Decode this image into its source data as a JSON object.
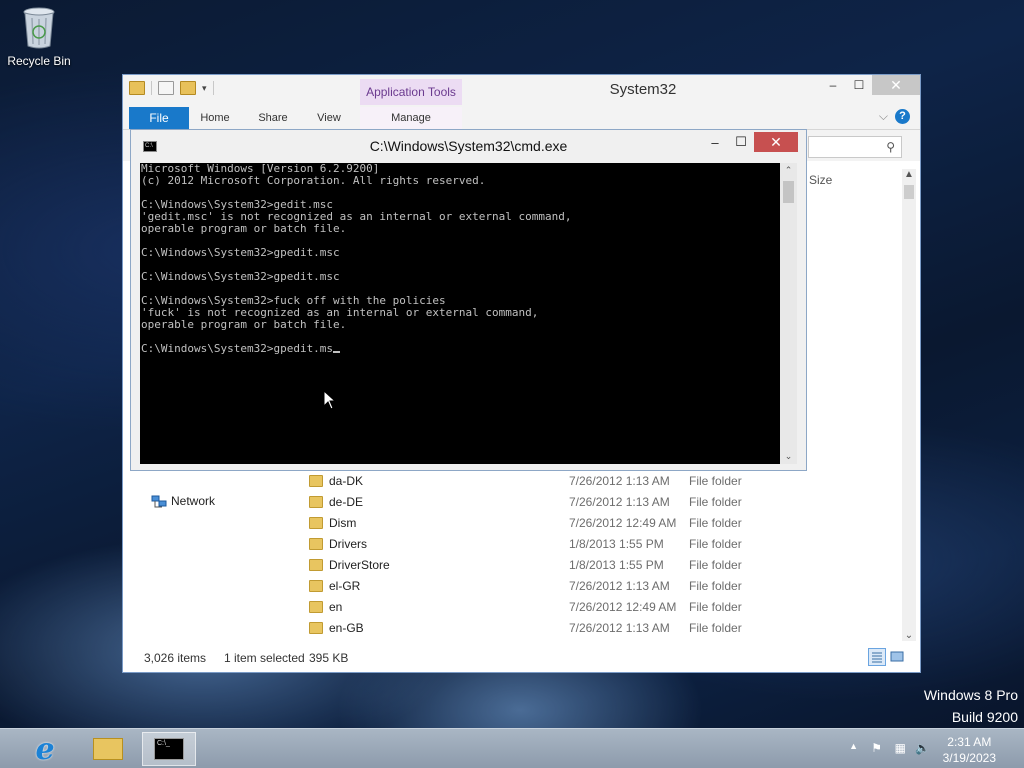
{
  "desktop": {
    "recycle_bin_label": "Recycle Bin",
    "watermark_line1": "Windows 8 Pro",
    "watermark_line2": "Build 9200"
  },
  "explorer": {
    "title": "System32",
    "context_tab": "Application Tools",
    "tabs": [
      "File",
      "Home",
      "Share",
      "View",
      "Manage"
    ],
    "column_size_label": "Size",
    "nav_network": "Network",
    "files": [
      {
        "name": "da-DK",
        "date": "7/26/2012 1:13 AM",
        "type": "File folder"
      },
      {
        "name": "de-DE",
        "date": "7/26/2012 1:13 AM",
        "type": "File folder"
      },
      {
        "name": "Dism",
        "date": "7/26/2012 12:49 AM",
        "type": "File folder"
      },
      {
        "name": "Drivers",
        "date": "1/8/2013 1:55 PM",
        "type": "File folder"
      },
      {
        "name": "DriverStore",
        "date": "1/8/2013 1:55 PM",
        "type": "File folder"
      },
      {
        "name": "el-GR",
        "date": "7/26/2012 1:13 AM",
        "type": "File folder"
      },
      {
        "name": "en",
        "date": "7/26/2012 12:49 AM",
        "type": "File folder"
      },
      {
        "name": "en-GB",
        "date": "7/26/2012 1:13 AM",
        "type": "File folder"
      }
    ],
    "status": {
      "items": "3,026 items",
      "selected": "1 item selected",
      "size": "395 KB"
    }
  },
  "cmd": {
    "title": "C:\\Windows\\System32\\cmd.exe",
    "lines": [
      "Microsoft Windows [Version 6.2.9200]",
      "(c) 2012 Microsoft Corporation. All rights reserved.",
      "",
      "C:\\Windows\\System32>gedit.msc",
      "'gedit.msc' is not recognized as an internal or external command,",
      "operable program or batch file.",
      "",
      "C:\\Windows\\System32>gpedit.msc",
      "",
      "C:\\Windows\\System32>gpedit.msc",
      "",
      "C:\\Windows\\System32>fuck off with the policies",
      "'fuck' is not recognized as an internal or external command,",
      "operable program or batch file.",
      ""
    ],
    "current_line": "C:\\Windows\\System32>gpedit.ms"
  },
  "taskbar": {
    "time": "2:31 AM",
    "date": "3/19/2023"
  }
}
